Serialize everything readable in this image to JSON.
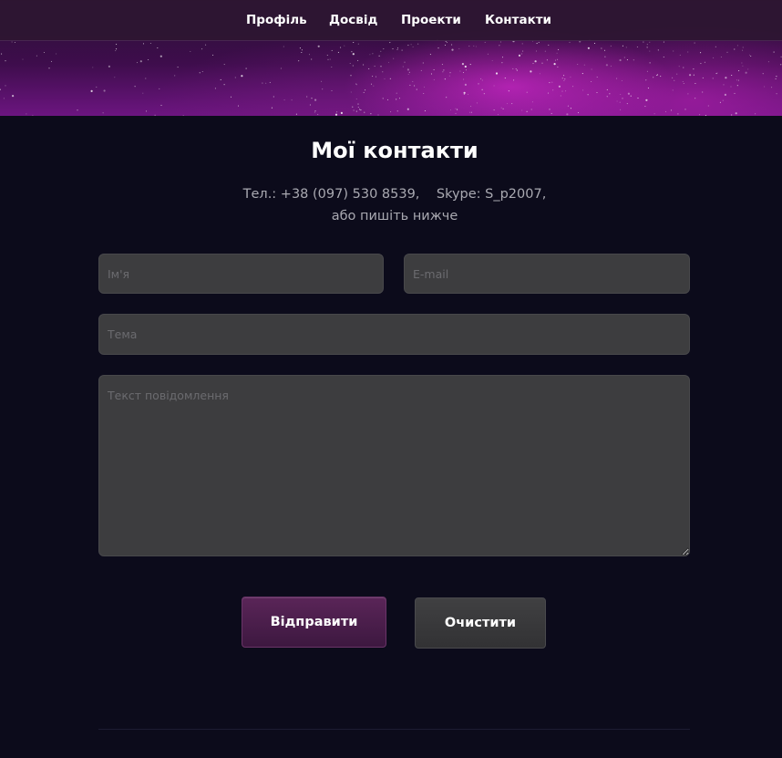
{
  "nav": {
    "items": [
      {
        "label": "Профіль"
      },
      {
        "label": "Досвід"
      },
      {
        "label": "Проекти"
      },
      {
        "label": "Контакти"
      }
    ]
  },
  "main": {
    "title": "Мої контакти",
    "contact": {
      "phone": "Тел.: +38 (097) 530 8539,",
      "skype": "Skype: S_p2007,",
      "note": "або пишіть нижче"
    }
  },
  "form": {
    "name": {
      "placeholder": "Ім'я",
      "value": ""
    },
    "email": {
      "placeholder": "E-mail",
      "value": ""
    },
    "subject": {
      "placeholder": "Тема",
      "value": ""
    },
    "message": {
      "placeholder": "Текст повідомлення",
      "value": ""
    },
    "send_label": "Відправити",
    "clear_label": "Очистити"
  },
  "colors": {
    "background": "#0c0b1b",
    "navbar": "#2d1632",
    "accent": "#5a2558",
    "field": "#3d3d3f"
  }
}
